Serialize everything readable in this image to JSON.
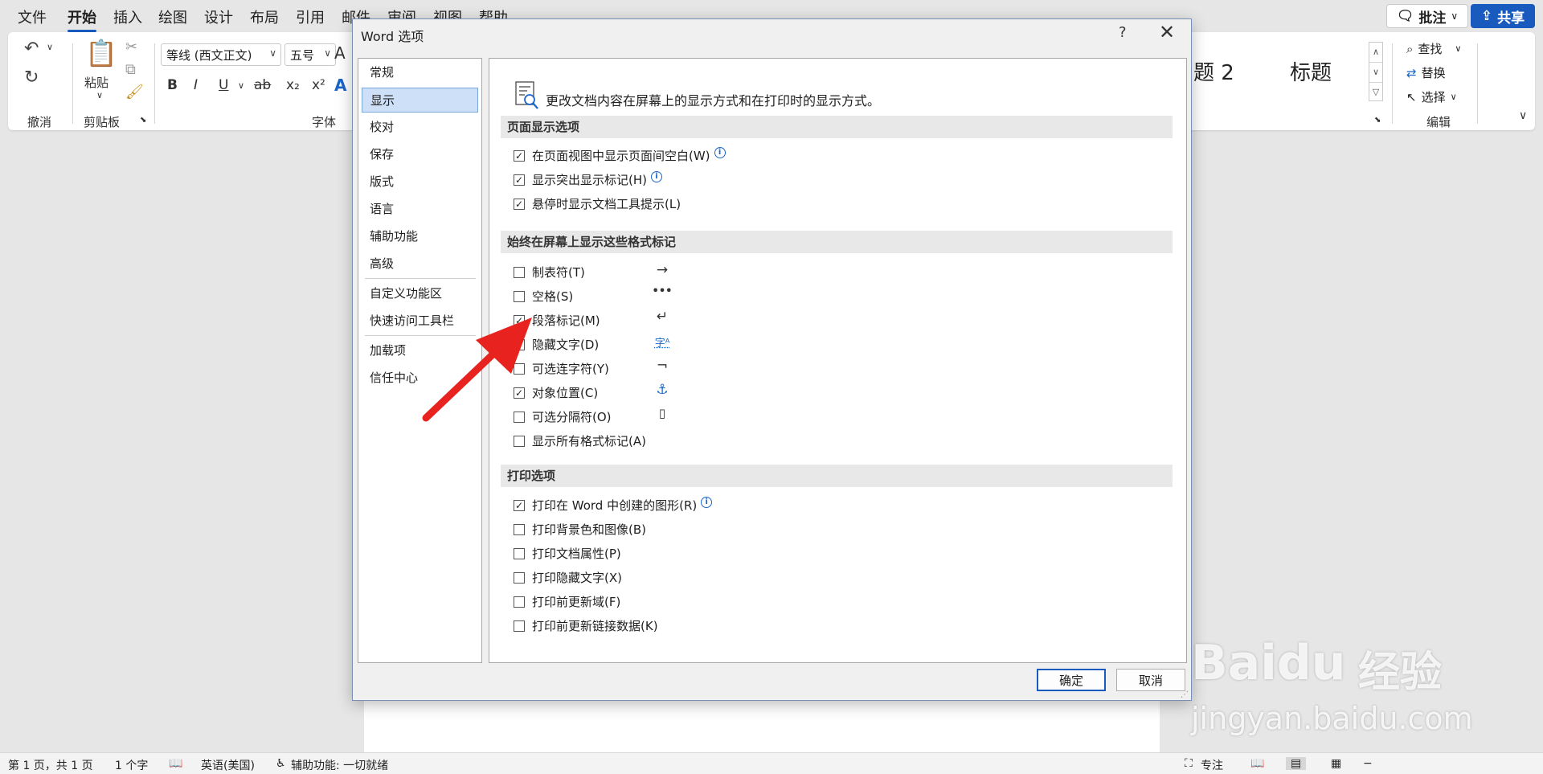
{
  "ribbon_tabs": [
    "文件",
    "开始",
    "插入",
    "绘图",
    "设计",
    "布局",
    "引用",
    "邮件",
    "审阅",
    "视图",
    "帮助"
  ],
  "top_buttons": {
    "comment": "批注",
    "share": "共享"
  },
  "ribbon": {
    "undo_label": "撤消",
    "paste_label": "粘贴",
    "clipboard_label": "剪贴板",
    "font_label": "字体",
    "font_name": "等线 (西文正文)",
    "font_size": "五号",
    "styles": [
      "题 2",
      "标题"
    ],
    "edit_label": "编辑",
    "find": "查找",
    "replace": "替换",
    "select": "选择"
  },
  "status_bar": {
    "page": "第 1 页，共 1 页",
    "words": "1 个字",
    "language": "英语(美国)",
    "accessibility": "辅助功能: 一切就绪",
    "focus": "专注"
  },
  "dialog": {
    "title": "Word 选项",
    "help": "?",
    "close": "✕",
    "nav": [
      "常规",
      "显示",
      "校对",
      "保存",
      "版式",
      "语言",
      "辅助功能",
      "高级",
      "自定义功能区",
      "快速访问工具栏",
      "加载项",
      "信任中心"
    ],
    "selected_nav": "显示",
    "intro": "更改文档内容在屏幕上的显示方式和在打印时的显示方式。",
    "sections": [
      {
        "title": "页面显示选项",
        "options": [
          {
            "label": "在页面视图中显示页面间空白(W)",
            "checked": true,
            "info": true
          },
          {
            "label": "显示突出显示标记(H)",
            "checked": true,
            "info": true
          },
          {
            "label": "悬停时显示文档工具提示(L)",
            "checked": true,
            "info": false
          }
        ]
      },
      {
        "title": "始终在屏幕上显示这些格式标记",
        "options": [
          {
            "label": "制表符(T)",
            "checked": false,
            "symbol": "→"
          },
          {
            "label": "空格(S)",
            "checked": false,
            "symbol": "•••"
          },
          {
            "label": "段落标记(M)",
            "checked": true,
            "symbol": "↵"
          },
          {
            "label": "隐藏文字(D)",
            "checked": false,
            "symbol": "字ᴬ"
          },
          {
            "label": "可选连字符(Y)",
            "checked": false,
            "symbol": "¬"
          },
          {
            "label": "对象位置(C)",
            "checked": true,
            "symbol": "⚓"
          },
          {
            "label": "可选分隔符(O)",
            "checked": false,
            "symbol": "▯"
          },
          {
            "label": "显示所有格式标记(A)",
            "checked": false,
            "symbol": ""
          }
        ]
      },
      {
        "title": "打印选项",
        "options": [
          {
            "label": "打印在 Word 中创建的图形(R)",
            "checked": true,
            "info": true
          },
          {
            "label": "打印背景色和图像(B)",
            "checked": false
          },
          {
            "label": "打印文档属性(P)",
            "checked": false
          },
          {
            "label": "打印隐藏文字(X)",
            "checked": false
          },
          {
            "label": "打印前更新域(F)",
            "checked": false
          },
          {
            "label": "打印前更新链接数据(K)",
            "checked": false
          }
        ]
      }
    ],
    "ok": "确定",
    "cancel": "取消"
  },
  "watermark": {
    "brand": "Baidu",
    "brand_cn": "经验",
    "url": "jingyan.baidu.com"
  },
  "colors": {
    "accent": "#185abd",
    "arrow": "#e8231f",
    "nav_selected": "#cde0f7"
  }
}
